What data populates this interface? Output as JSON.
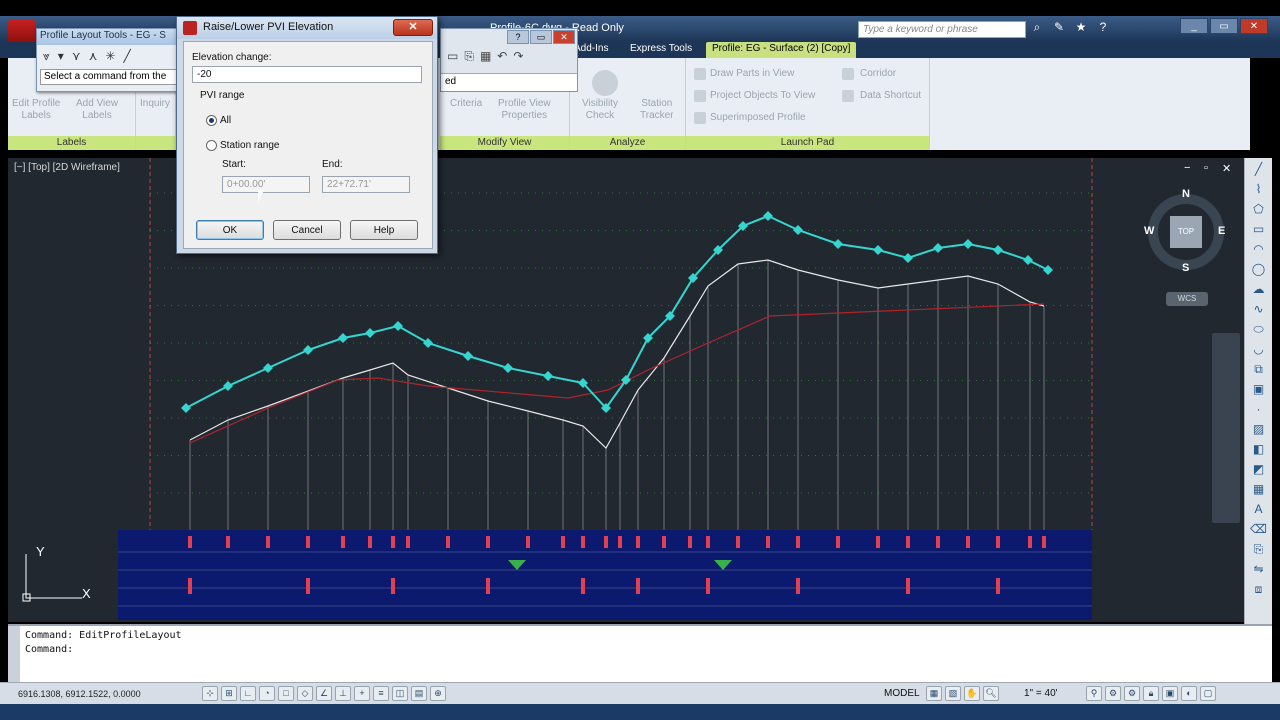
{
  "titlebar": {
    "doc_title": "Profile-6C.dwg - Read Only",
    "search_placeholder": "Type a keyword or phrase",
    "window_buttons": [
      "_",
      "▭",
      "✕"
    ]
  },
  "ribbon_tabs": {
    "addins": "Add-Ins",
    "express": "Express Tools",
    "contextual": "Profile: EG - Surface (2) [Copy]"
  },
  "ribbon": {
    "labels_panel": {
      "edit_profile_labels": "Edit Profile\nLabels",
      "add_view_labels": "Add View\nLabels",
      "inquiry": "Inquiry",
      "title": "Labels"
    },
    "modify_view_panel": {
      "criteria": "Criteria",
      "profile_view_properties": "Profile View\nProperties",
      "title": "Modify View"
    },
    "analyze_panel": {
      "visibility_check": "Visibility\nCheck",
      "station_tracker": "Station\nTracker",
      "title": "Analyze"
    },
    "launch_pad_panel": {
      "draw_parts_in_view": "Draw Parts in View",
      "project_objects": "Project Objects To View",
      "superimposed_profile": "Superimposed Profile",
      "corridor": "Corridor",
      "data_shortcut": "Data Shortcut",
      "title": "Launch Pad"
    }
  },
  "profile_layout_toolbar": {
    "title": "Profile Layout Tools - EG - S",
    "prompt": "Select a command from the"
  },
  "small_window": {
    "field_suffix": "ed"
  },
  "dialog": {
    "title": "Raise/Lower PVI Elevation",
    "elevation_label": "Elevation change:",
    "elevation_value": "-20",
    "range_label": "PVI range",
    "all_label": "All",
    "station_range_label": "Station range",
    "start_label": "Start:",
    "start_value": "0+00.00'",
    "end_label": "End:",
    "end_value": "22+72.71'",
    "ok": "OK",
    "cancel": "Cancel",
    "help": "Help"
  },
  "viewport": {
    "label": "[−] [Top] [2D Wireframe]",
    "controls": [
      "−",
      "▫",
      "✕"
    ],
    "viewcube_face": "TOP",
    "compass": {
      "n": "N",
      "s": "S",
      "e": "E",
      "w": "W"
    },
    "wcs": "WCS",
    "ucs_y": "Y",
    "ucs_x": "X"
  },
  "command_line": {
    "line1": "Command: EditProfileLayout",
    "line2": "Command:"
  },
  "statusbar": {
    "coords": "6916.1308, 6912.1522, 0.0000",
    "model": "MODEL",
    "scale": "1\" = 40'"
  },
  "colors": {
    "profile_ground": "#e8e8e8",
    "profile_design": "#b0242e",
    "grips": "#35d6d0",
    "grid_vertical": "#ffffff",
    "grid_horizontal": "#3fbf3f",
    "band_background": "#0b1a6e"
  }
}
